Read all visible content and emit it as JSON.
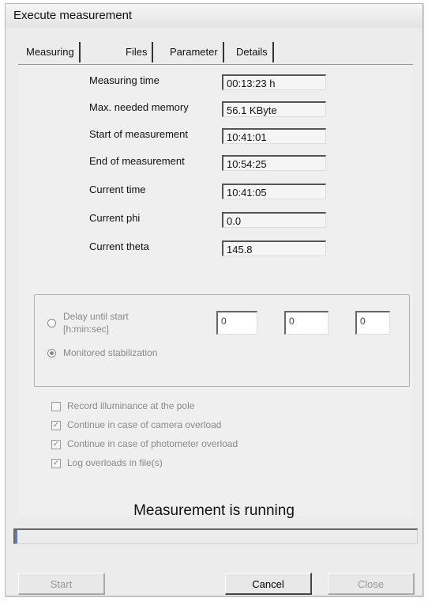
{
  "window": {
    "title": "Execute measurement"
  },
  "tabs": [
    {
      "label": "Measuring state"
    },
    {
      "label": "Files"
    },
    {
      "label": "Parameter"
    },
    {
      "label": "Details"
    }
  ],
  "measuring_state": {
    "fields": [
      {
        "label": "Measuring time",
        "value": "00:13:23 h"
      },
      {
        "label": "Max. needed memory",
        "value": "56.1 KByte"
      },
      {
        "label": "Start of measurement",
        "value": "10:41:01"
      },
      {
        "label": "End of measurement",
        "value": "10:54:25"
      },
      {
        "label": "Current time",
        "value": "10:41:05"
      },
      {
        "label": "Current phi",
        "value": "0.0"
      },
      {
        "label": "Current theta",
        "value": "145.8"
      }
    ],
    "delay": {
      "label_line1": "Delay until start",
      "label_line2": "[h:min:sec]",
      "hours": "0",
      "minutes": "0",
      "seconds": "0"
    },
    "monitored_label": "Monitored stabilization",
    "checkboxes": [
      {
        "label": "Record illuminance at the pole",
        "checked": false
      },
      {
        "label": "Continue in case of camera overload",
        "checked": true
      },
      {
        "label": "Continue in case of photometer overload",
        "checked": true
      },
      {
        "label": "Log overloads in file(s)",
        "checked": true
      }
    ]
  },
  "status": {
    "text": "Measurement is running",
    "progress": 0.005
  },
  "buttons": {
    "start": "Start",
    "cancel": "Cancel",
    "close": "Close"
  },
  "colors": {
    "progress_fill": "#4f81bd",
    "dialog_bg": "#ececec"
  }
}
